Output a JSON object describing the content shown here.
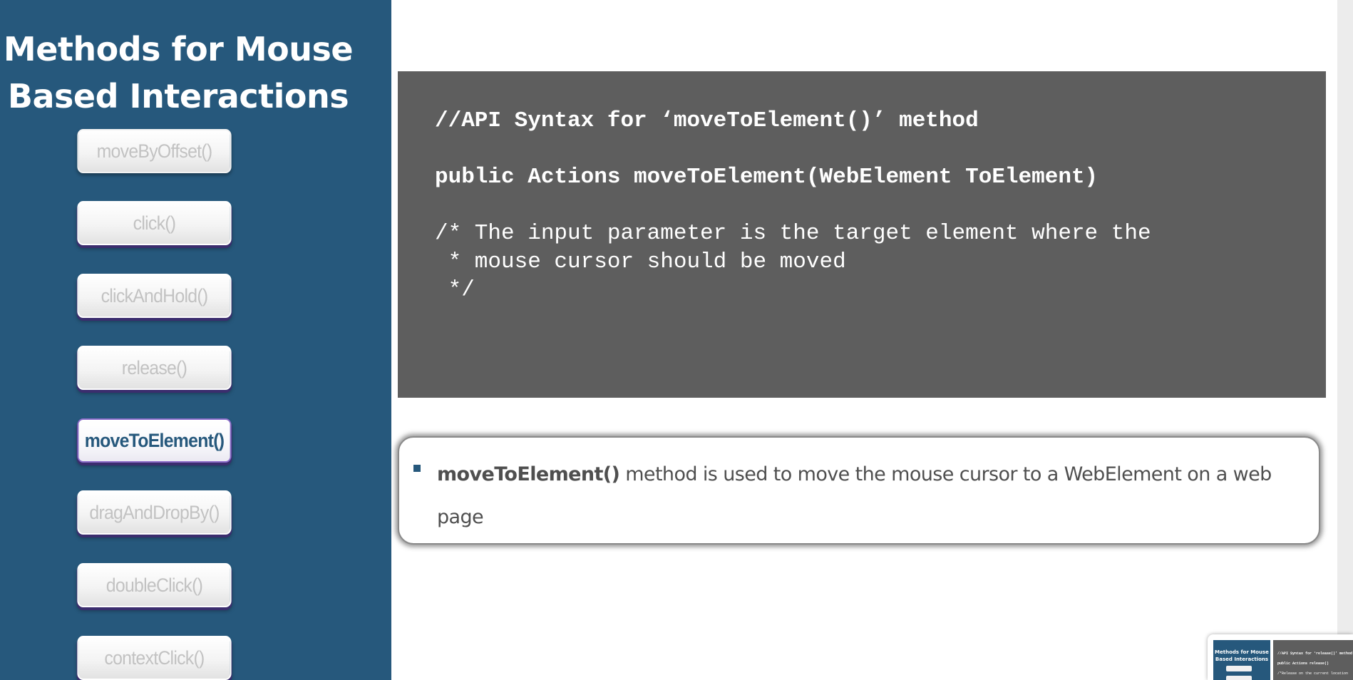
{
  "sidebar": {
    "title_line1": "Methods for Mouse",
    "title_line2": "Based Interactions",
    "methods": [
      {
        "label": "moveByOffset()",
        "active": false
      },
      {
        "label": "click()",
        "active": false
      },
      {
        "label": "clickAndHold()",
        "active": false
      },
      {
        "label": "release()",
        "active": false
      },
      {
        "label": "moveToElement()",
        "active": true
      },
      {
        "label": "dragAndDropBy()",
        "active": false
      },
      {
        "label": "doubleClick()",
        "active": false
      },
      {
        "label": "contextClick()",
        "active": false
      }
    ]
  },
  "code": {
    "comment_line": "//API Syntax for ‘moveToElement()’ method",
    "signature_line": "public Actions moveToElement(WebElement ToElement)",
    "doc_line1": "/* The input parameter is the target element where the",
    "doc_line2": " * mouse cursor should be moved",
    "doc_line3": " */"
  },
  "description": {
    "bold_text": "moveToElement()",
    "rest_text": " method is used to move the mouse cursor to a WebElement on a web page"
  },
  "thumbnail": {
    "title_line1": "Methods for Mouse",
    "title_line2": "Based Interactions",
    "code_line1": "//API Syntax for ‘release()’ method",
    "code_line2": "public Actions release()",
    "code_line3": "/*Release on the current location"
  },
  "colors": {
    "sidebar_bg": "#26587c",
    "code_bg": "#5e5e5e",
    "active_text": "#26587c",
    "inactive_text": "#c2c2c2",
    "bullet": "#26587c"
  }
}
